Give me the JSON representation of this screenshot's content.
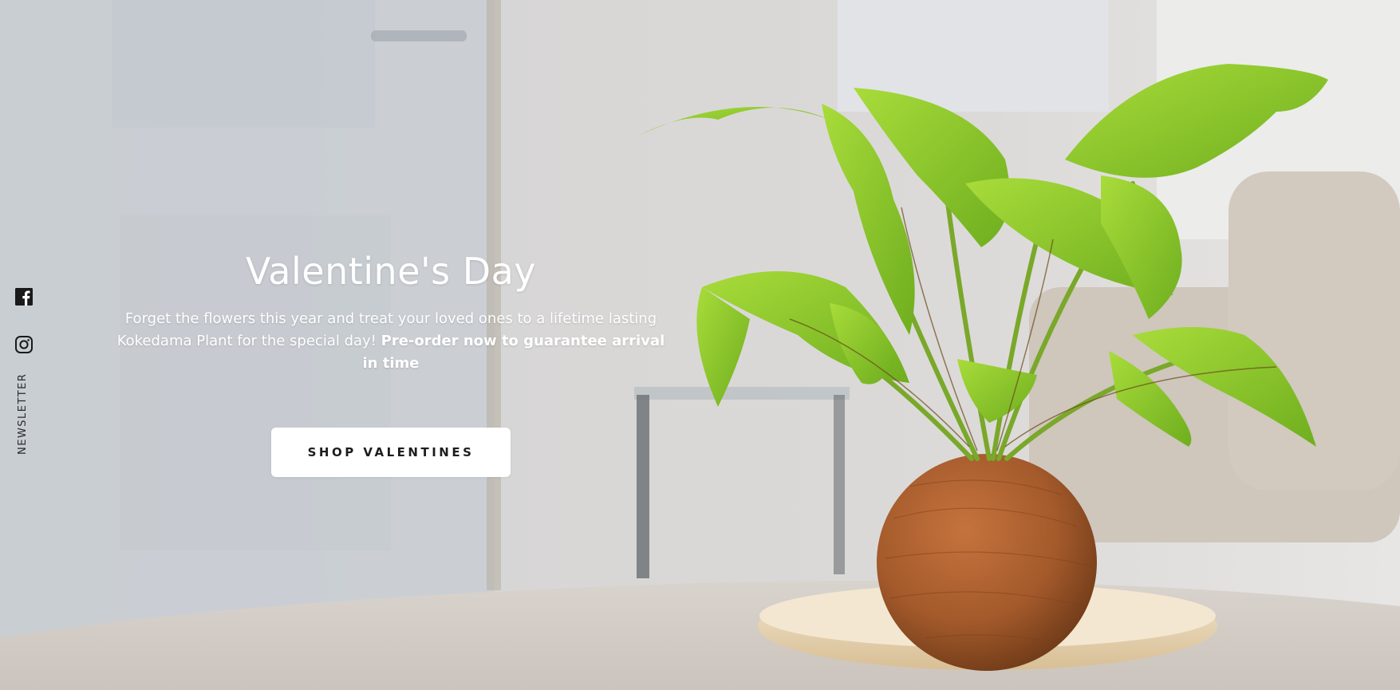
{
  "hero": {
    "title": "Valentine's Day",
    "description_regular": "Forget the flowers this year and treat your loved ones to a lifetime lasting Kokedama Plant for the special day! ",
    "description_bold": "Pre-order now to guarantee arrival in time",
    "cta_label": "SHOP VALENTINES"
  },
  "sidebar": {
    "social": [
      {
        "icon": "facebook-icon"
      },
      {
        "icon": "instagram-icon"
      }
    ],
    "newsletter_label": "NEWSLETTER"
  },
  "colors": {
    "text_on_hero": "#ffffff",
    "button_bg": "#ffffff",
    "button_text": "#1d1d1d",
    "rail_icons": "#1a1a1a"
  }
}
